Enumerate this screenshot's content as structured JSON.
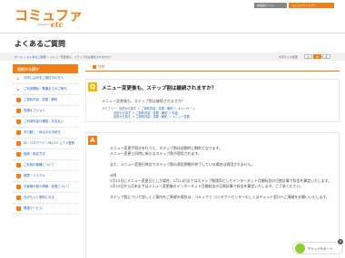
{
  "brand": {
    "logo": "コミュファ",
    "sub": "Powered by",
    "ctc": "ctc",
    "color": "#f07d17"
  },
  "topnav": {
    "mypage": "本会員ページ",
    "commufa_top": "コミュファトップへ"
  },
  "page_title": "よくあるご質問",
  "breadcrumb": {
    "home": "ホーム",
    "sep": " > ",
    "faq": "よくあるご質問",
    "rest": "メニュー変更後も、ステップ割は継続されますか？"
  },
  "font_size": {
    "label": "文字サイズ変更",
    "small": "小",
    "medium": "中",
    "large": "大"
  },
  "sidebar": {
    "heading": "目的から探す",
    "items": [
      {
        "label": "お申し込みをご検討中の方へ",
        "icon": "bullet"
      },
      {
        "label": "ご利用開始・開通までのご案内",
        "icon": "bullet"
      },
      {
        "label": "ご契約内容・変更・解約",
        "icon": "document-icon"
      },
      {
        "label": "各種オプション",
        "icon": "option-icon"
      },
      {
        "label": "ご利用料金の確認・お支払い",
        "icon": "yen-icon"
      },
      {
        "label": "お引越し・休止のお手続き",
        "icon": "truck-icon"
      },
      {
        "label": "ID・パスワード・Myコミュファ登録",
        "icon": "key-icon"
      },
      {
        "label": "接続・設定方法",
        "icon": "network-icon"
      },
      {
        "label": "ご利用の機器について",
        "icon": "device-icon"
      },
      {
        "label": "故障・トラブル",
        "icon": "warning-icon"
      },
      {
        "label": "お客様の個人情報・変更について",
        "icon": "person-icon"
      },
      {
        "label": "光がもっと便利になる",
        "icon": "light-icon"
      },
      {
        "label": "関連サービス",
        "icon": "service-icon"
      }
    ]
  },
  "main": {
    "tag": "質問",
    "question": "メニュー変更後も、ステップ割は継続されますか？",
    "question_sub": "メニュー変更後も、ステップ割は継続されますか？",
    "category_label": "カテゴリー：",
    "categories": [
      "目的から探す ＞ ご契約内容・変更・解約 ＞ キャンペーン",
      "目的から探す ＞ ご契約内容・変更・解約 ＞ 料金",
      "目的から探す ＞ ご契約内容・変更・解約 ＞ メニュー変更"
    ],
    "answer_paragraphs": [
      "メニュー変更手続きを行うと、ステップ割は自動的に解約となります。\nメニュー変更と同時に新たなステップ割が適用されます。",
      "また、メニュー変更日時点でステップ割の適用期間が終了している場合は適用されません。",
      "※例\n1月15日にメニュー変更日とした場合、1月14日まではステップ割適用としたインターネット月額料金の日割計算で料金を算定いたします。\n1月15日から月末まではメニュー変更後のインターネット月額料金の日割計算で料金を算定いたします。ご了承ください。",
      "ステップ割について詳しくご案内をご希望の場合は、コミュファ コンタクトセンターもしくはチャット窓口へご連絡をお願いいたします。"
    ]
  },
  "chat": {
    "label": "チャットサポート",
    "close": "×",
    "color": "#8fcf2d"
  }
}
